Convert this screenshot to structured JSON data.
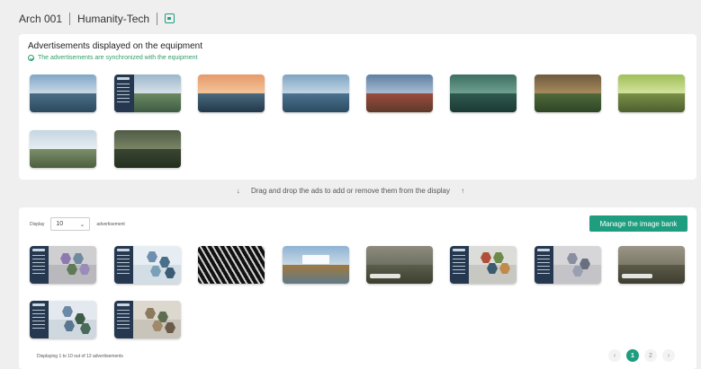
{
  "header": {
    "equipment": "Arch 001",
    "organization": "Humanity-Tech"
  },
  "top_panel": {
    "title": "Advertisements displayed on the equipment",
    "sync_text": "The advertisements are synchronized with the equipment"
  },
  "dnd_text": "Drag and drop the ads to add or remove them from the display",
  "bottom_panel": {
    "display_label": "Display",
    "display_value": "10",
    "display_suffix": "advertisement",
    "manage_button": "Manage the image bank",
    "footer_text": "Displaying 1 to 10 out of 12 advertisements",
    "pagination": {
      "pages": [
        "1",
        "2"
      ],
      "current": "1"
    }
  },
  "colors": {
    "accent": "#1e9e7e",
    "sync_green": "#2f9e6b"
  }
}
